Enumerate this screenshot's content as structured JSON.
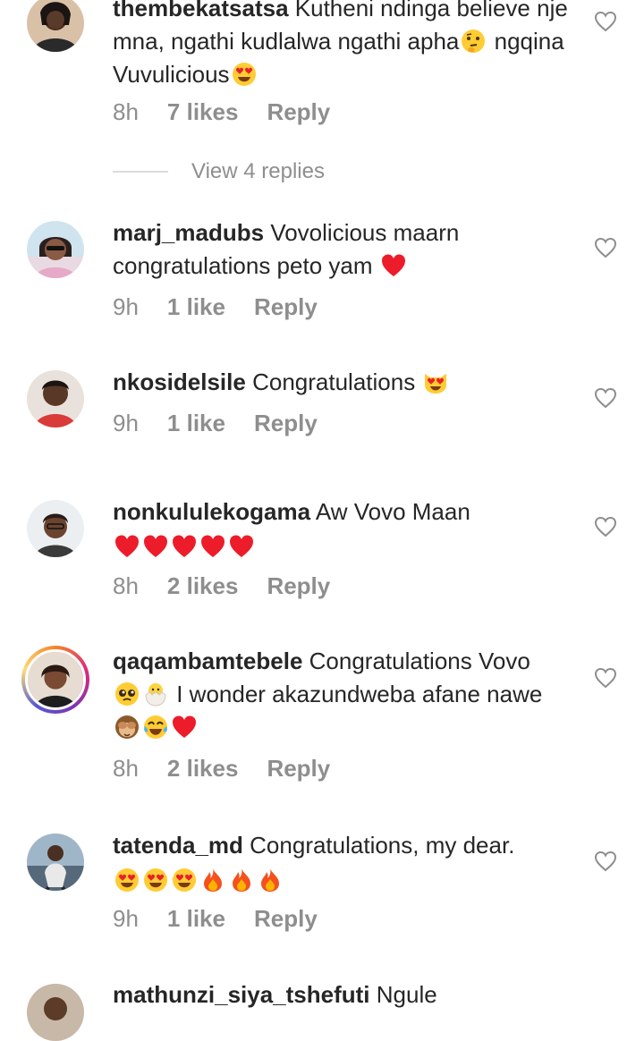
{
  "comments": [
    {
      "username": "thembekatsatsa",
      "text_parts": [
        "Kutheni ndinga believe nje mna, ngathi kudlalwa ngathi apha",
        "thinking",
        " ngqina Vuvulicious",
        "heart-eyes"
      ],
      "time": "8h",
      "likes": "7 likes",
      "reply": "Reply"
    },
    {
      "username": "marj_madubs",
      "text_parts": [
        "Vovolicious maarn congratulations peto yam ",
        "red-heart"
      ],
      "time": "9h",
      "likes": "1 like",
      "reply": "Reply"
    },
    {
      "username": "nkosidelsile",
      "text_parts": [
        "Congratulations ",
        "cat-heart-eyes"
      ],
      "time": "9h",
      "likes": "1 like",
      "reply": "Reply"
    },
    {
      "username": "nonkululekogama",
      "text_parts": [
        "Aw Vovo Maan"
      ],
      "time": "8h",
      "likes": "2 likes",
      "reply": "Reply"
    },
    {
      "username": "qaqambamtebele",
      "text_parts": [
        "Congratulations Vovo",
        "pleading",
        "hatching-chick",
        " I wonder akazundweba afane nawe ",
        "see-no-evil",
        "tears-of-joy",
        "red-heart"
      ],
      "time": "8h",
      "likes": "2 likes",
      "reply": "Reply"
    },
    {
      "username": "tatenda_md",
      "text_parts": [
        "Congratulations, my dear."
      ],
      "time": "9h",
      "likes": "1 like",
      "reply": "Reply"
    },
    {
      "username": "mathunzi_siya_tshefuti",
      "text_parts": [
        "Ngule"
      ]
    }
  ],
  "view_replies": "View 4 replies",
  "icons": {
    "like": "heart-outline-icon",
    "emoji_names": [
      "thinking",
      "heart-eyes",
      "red-heart",
      "cat-heart-eyes",
      "pleading",
      "hatching-chick",
      "see-no-evil",
      "tears-of-joy",
      "fire"
    ]
  },
  "colors": {
    "text": "#262626",
    "meta": "#8e8e8e",
    "heart": "#ed1c2a",
    "divider": "#dbdbdb"
  }
}
